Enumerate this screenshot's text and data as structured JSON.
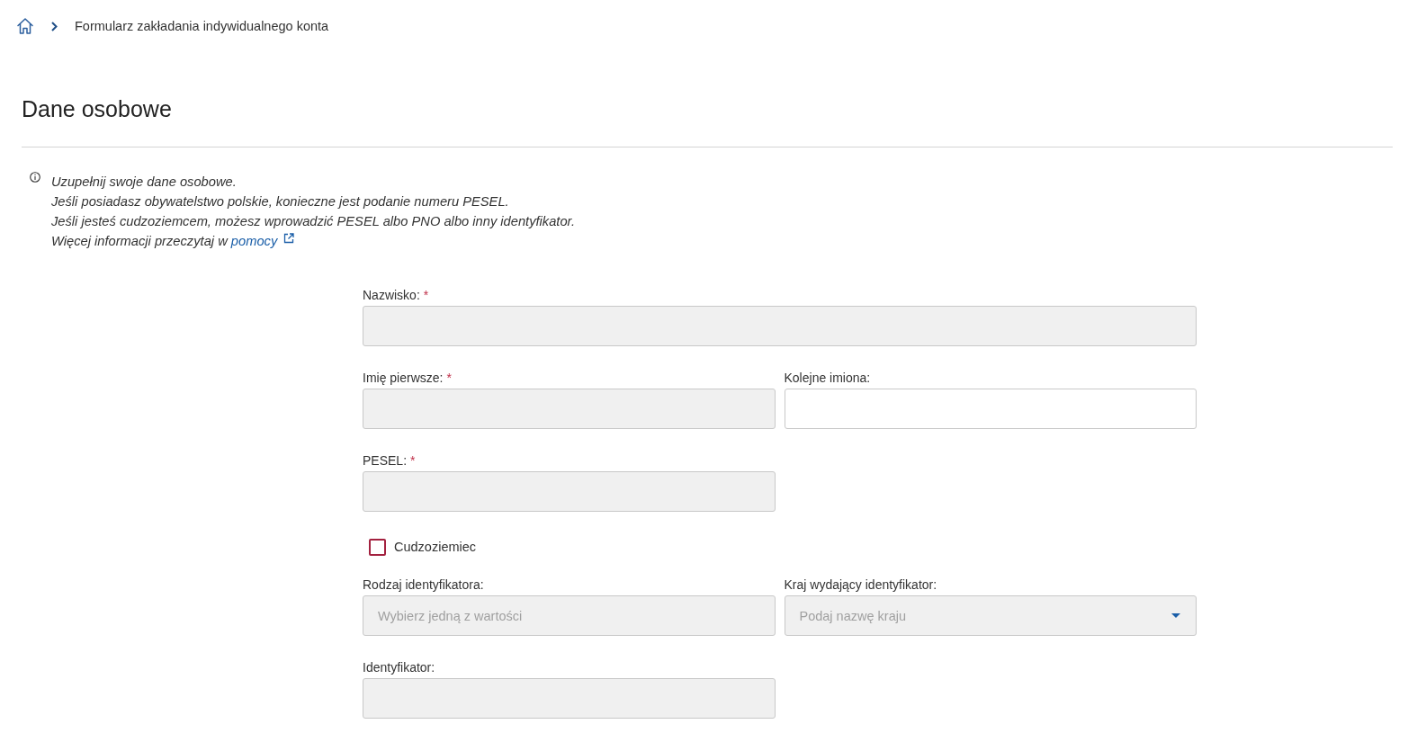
{
  "breadcrumb": [
    {
      "label": "Formularz zakładania indywidualnego konta"
    }
  ],
  "heading": "Dane osobowe",
  "info": {
    "lines": [
      "Uzupełnij swoje dane osobowe.",
      "Jeśli posiadasz obywatelstwo polskie, konieczne jest podanie numeru PESEL.",
      "Jeśli jesteś cudzoziemcem, możesz wprowadzić PESEL albo PNO albo inny identyfikator."
    ],
    "link_line": {
      "text": "Więcej informacji przeczytaj w",
      "link": "pomocy"
    }
  },
  "form": {
    "rows": [
      {
        "fields": [
          {
            "kind": "text",
            "label": "Nazwisko:",
            "required_mark": "*",
            "disabled": true,
            "wide": true
          }
        ]
      },
      {
        "fields": [
          {
            "kind": "text",
            "label": "Imię pierwsze:",
            "required_mark": "*",
            "disabled": true,
            "wide": false
          },
          {
            "kind": "text",
            "label": "Kolejne imiona:",
            "disabled": false,
            "wide": false
          }
        ]
      },
      {
        "fields": [
          {
            "kind": "text",
            "label": "PESEL:",
            "required_mark": "*",
            "disabled": true,
            "wide": false
          }
        ]
      },
      {
        "fields": [
          {
            "kind": "checkbox",
            "label": "Cudzoziemiec",
            "checked": false
          }
        ]
      },
      {
        "fields": [
          {
            "kind": "text",
            "label": "Rodzaj identyfikatora:",
            "placeholder": "Wybierz jedną z wartości",
            "disabled": true,
            "wide": false
          },
          {
            "kind": "select",
            "label": "Kraj wydający identyfikator:",
            "placeholder": "Podaj nazwę kraju",
            "disabled": true,
            "wide": false
          }
        ]
      },
      {
        "fields": [
          {
            "kind": "text",
            "label": "Identyfikator:",
            "disabled": true,
            "wide": false
          }
        ]
      }
    ]
  }
}
